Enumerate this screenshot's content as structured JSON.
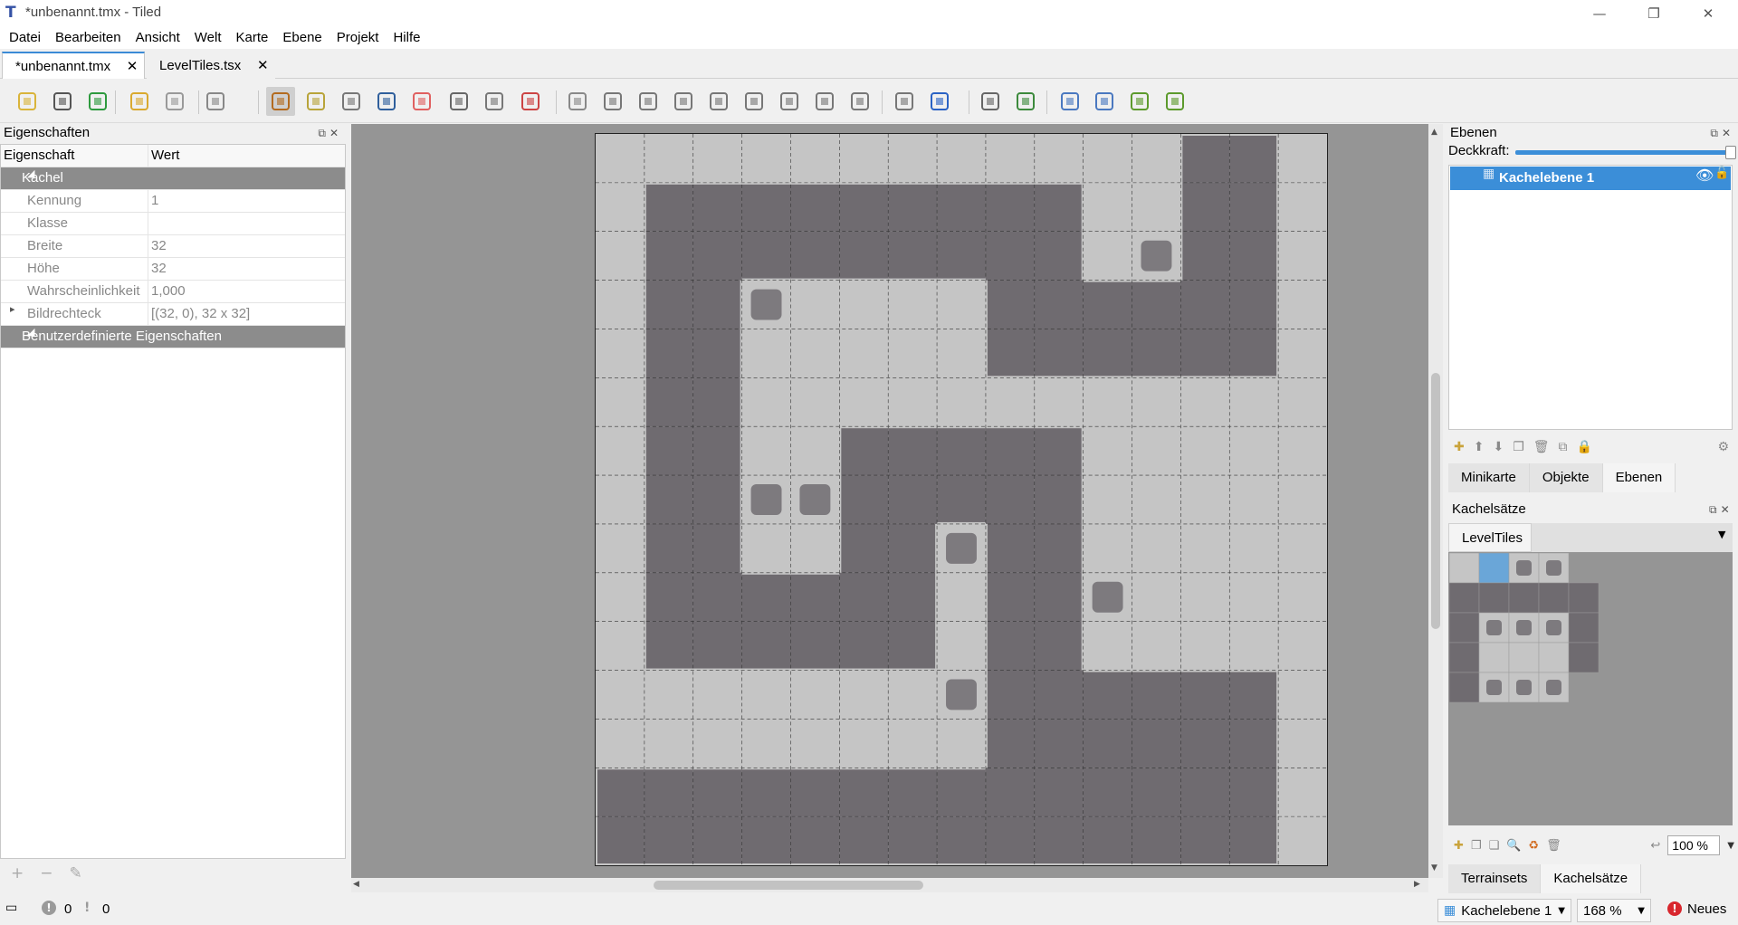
{
  "window": {
    "title": "*unbenannt.tmx - Tiled",
    "minimize_glyph": "—",
    "maximize_glyph": "❐",
    "close_glyph": "✕"
  },
  "menu": [
    "Datei",
    "Bearbeiten",
    "Ansicht",
    "Welt",
    "Karte",
    "Ebene",
    "Projekt",
    "Hilfe"
  ],
  "tabs": [
    {
      "label": "*unbenannt.tmx",
      "active": true
    },
    {
      "label": "LevelTiles.tsx",
      "active": false
    }
  ],
  "toolbar_icons": [
    "new-map-icon",
    "open-icon",
    "save-icon",
    "undo-icon",
    "redo-icon",
    "commands-icon",
    "stamp-brush-icon",
    "terrain-brush-icon",
    "bucket-fill-icon",
    "shape-fill-icon",
    "eraser-icon",
    "rect-select-icon",
    "magic-wand-icon",
    "select-same-tile-icon",
    "select-objects-icon",
    "edit-polygons-icon",
    "insert-rectangle-icon",
    "insert-point-icon",
    "insert-ellipse-icon",
    "insert-polygon-icon",
    "insert-tile-icon",
    "insert-template-icon",
    "insert-text-icon",
    "world-tool-icon",
    "move-world-icon",
    "random-mode-icon",
    "wang-fill-icon",
    "flip-horizontal-icon",
    "flip-vertical-icon",
    "rotate-left-icon",
    "rotate-right-icon"
  ],
  "properties": {
    "title": "Eigenschaften",
    "col_property": "Eigenschaft",
    "col_value": "Wert",
    "group_tile": "Kachel",
    "rows": [
      {
        "key": "Kennung",
        "value": "1"
      },
      {
        "key": "Klasse",
        "value": ""
      },
      {
        "key": "Breite",
        "value": "32"
      },
      {
        "key": "Höhe",
        "value": "32"
      },
      {
        "key": "Wahrscheinlichkeit",
        "value": "1,000"
      },
      {
        "key": "Bildrechteck",
        "value": "[(32, 0), 32 x 32]"
      }
    ],
    "group_custom": "Benutzerdefinierte Eigenschaften"
  },
  "map": {
    "grid_cols": 15,
    "grid_rows": 15,
    "wall_color": "#6f6b70",
    "floor_color": "#c5c5c5",
    "wall_tiles": [
      [
        12,
        0
      ],
      [
        13,
        0
      ],
      [
        1,
        1
      ],
      [
        2,
        1
      ],
      [
        3,
        1
      ],
      [
        4,
        1
      ],
      [
        5,
        1
      ],
      [
        6,
        1
      ],
      [
        7,
        1
      ],
      [
        8,
        1
      ],
      [
        9,
        1
      ],
      [
        12,
        1
      ],
      [
        13,
        1
      ],
      [
        1,
        2
      ],
      [
        2,
        2
      ],
      [
        3,
        2
      ],
      [
        4,
        2
      ],
      [
        5,
        2
      ],
      [
        6,
        2
      ],
      [
        7,
        2
      ],
      [
        8,
        2
      ],
      [
        9,
        2
      ],
      [
        12,
        2
      ],
      [
        13,
        2
      ],
      [
        1,
        3
      ],
      [
        2,
        3
      ],
      [
        8,
        3
      ],
      [
        9,
        3
      ],
      [
        10,
        3
      ],
      [
        11,
        3
      ],
      [
        12,
        3
      ],
      [
        13,
        3
      ],
      [
        1,
        4
      ],
      [
        2,
        4
      ],
      [
        8,
        4
      ],
      [
        9,
        4
      ],
      [
        10,
        4
      ],
      [
        11,
        4
      ],
      [
        12,
        4
      ],
      [
        13,
        4
      ],
      [
        1,
        5
      ],
      [
        2,
        5
      ],
      [
        1,
        6
      ],
      [
        2,
        6
      ],
      [
        5,
        6
      ],
      [
        6,
        6
      ],
      [
        7,
        6
      ],
      [
        8,
        6
      ],
      [
        9,
        6
      ],
      [
        1,
        7
      ],
      [
        2,
        7
      ],
      [
        5,
        7
      ],
      [
        6,
        7
      ],
      [
        7,
        7
      ],
      [
        8,
        7
      ],
      [
        9,
        7
      ],
      [
        1,
        8
      ],
      [
        2,
        8
      ],
      [
        5,
        8
      ],
      [
        6,
        8
      ],
      [
        8,
        8
      ],
      [
        9,
        8
      ],
      [
        1,
        9
      ],
      [
        2,
        9
      ],
      [
        3,
        9
      ],
      [
        4,
        9
      ],
      [
        5,
        9
      ],
      [
        6,
        9
      ],
      [
        8,
        9
      ],
      [
        9,
        9
      ],
      [
        1,
        10
      ],
      [
        2,
        10
      ],
      [
        3,
        10
      ],
      [
        4,
        10
      ],
      [
        5,
        10
      ],
      [
        6,
        10
      ],
      [
        8,
        10
      ],
      [
        9,
        10
      ],
      [
        8,
        11
      ],
      [
        9,
        11
      ],
      [
        10,
        11
      ],
      [
        11,
        11
      ],
      [
        12,
        11
      ],
      [
        13,
        11
      ],
      [
        8,
        12
      ],
      [
        9,
        12
      ],
      [
        10,
        12
      ],
      [
        11,
        12
      ],
      [
        12,
        12
      ],
      [
        13,
        12
      ],
      [
        0,
        13
      ],
      [
        1,
        13
      ],
      [
        2,
        13
      ],
      [
        3,
        13
      ],
      [
        4,
        13
      ],
      [
        5,
        13
      ],
      [
        6,
        13
      ],
      [
        7,
        13
      ],
      [
        8,
        13
      ],
      [
        9,
        13
      ],
      [
        10,
        13
      ],
      [
        11,
        13
      ],
      [
        12,
        13
      ],
      [
        13,
        13
      ],
      [
        0,
        14
      ],
      [
        1,
        14
      ],
      [
        2,
        14
      ],
      [
        3,
        14
      ],
      [
        4,
        14
      ],
      [
        5,
        14
      ],
      [
        6,
        14
      ],
      [
        7,
        14
      ],
      [
        8,
        14
      ],
      [
        9,
        14
      ],
      [
        10,
        14
      ],
      [
        11,
        14
      ],
      [
        12,
        14
      ],
      [
        13,
        14
      ]
    ],
    "block_tiles": [
      [
        11,
        2
      ],
      [
        3,
        3
      ],
      [
        3,
        7
      ],
      [
        4,
        7
      ],
      [
        7,
        8
      ],
      [
        10,
        9
      ],
      [
        7,
        11
      ]
    ]
  },
  "layers": {
    "title": "Ebenen",
    "opacity_label": "Deckkraft:",
    "opacity": 1.0,
    "items": [
      {
        "name": "Kachelebene 1",
        "visible": true,
        "locked": false
      }
    ],
    "tabs": [
      {
        "label": "Minikarte",
        "active": false
      },
      {
        "label": "Objekte",
        "active": false
      },
      {
        "label": "Ebenen",
        "active": true
      }
    ]
  },
  "tilesets": {
    "title": "Kachelsätze",
    "current": "LevelTiles",
    "zoom": "100 %",
    "tabs": [
      {
        "label": "Terrainsets",
        "active": false
      },
      {
        "label": "Kachelsätze",
        "active": true
      }
    ]
  },
  "status": {
    "errors": "0",
    "warnings": "0",
    "layer": "Kachelebene 1",
    "zoom": "168 %",
    "news": "Neues"
  },
  "colors": {
    "accent": "#3b8ed8"
  }
}
